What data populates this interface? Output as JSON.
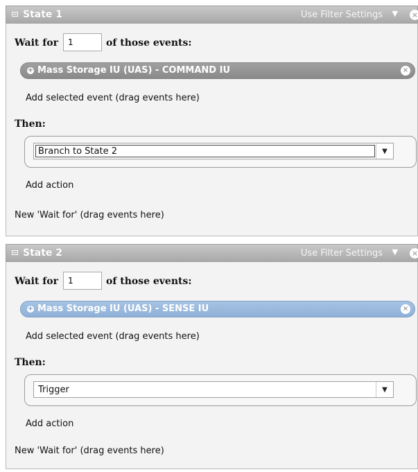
{
  "states": [
    {
      "title": "State 1",
      "filter_settings": "Use Filter Settings",
      "wait_for_label": "Wait for",
      "wait_count": "1",
      "of_those_events": "of those events:",
      "event": "Mass Storage IU (UAS) - COMMAND IU",
      "add_event_hint": "Add selected event (drag events here)",
      "then_label": "Then:",
      "action": "Branch to State 2",
      "add_action": "Add action",
      "new_wait_for": "New 'Wait for' (drag events here)"
    },
    {
      "title": "State 2",
      "filter_settings": "Use Filter Settings",
      "wait_for_label": "Wait for",
      "wait_count": "1",
      "of_those_events": "of those events:",
      "event": "Mass Storage IU (UAS) - SENSE IU",
      "add_event_hint": "Add selected event (drag events here)",
      "then_label": "Then:",
      "action": "Trigger",
      "add_action": "Add action",
      "new_wait_for": "New 'Wait for' (drag events here)"
    }
  ],
  "icons": {
    "collapse": "collapse-icon",
    "dropdown": "chevron-down-icon",
    "close": "close-icon",
    "expand_event": "plus-icon",
    "remove_event": "remove-icon"
  },
  "colors": {
    "header_gray": "#a9a9a9",
    "event_gray": "#8a8a8a",
    "event_selected_blue": "#8fb1d7"
  }
}
